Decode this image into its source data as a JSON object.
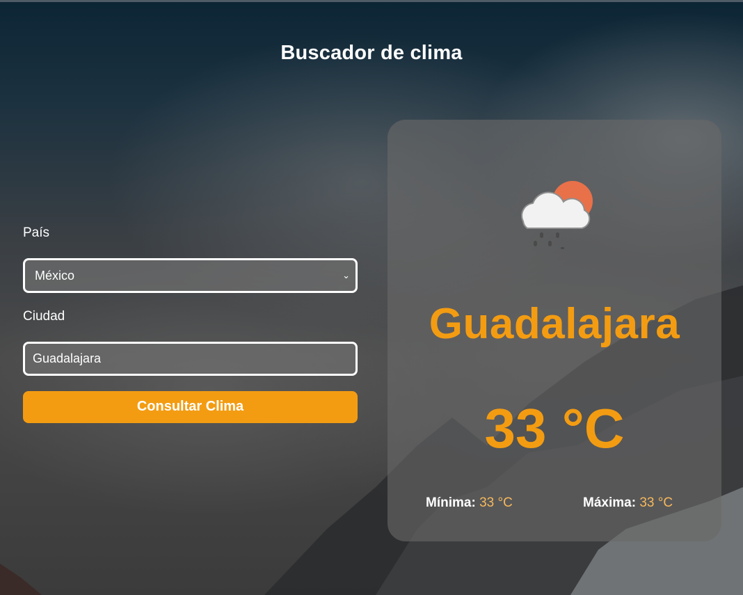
{
  "app": {
    "title": "Buscador de clima"
  },
  "form": {
    "country_label": "País",
    "country_value": "México",
    "city_label": "Ciudad",
    "city_value": "Guadalajara",
    "submit_label": "Consultar Clima"
  },
  "result": {
    "icon": "rain-cloud-sun-icon",
    "city": "Guadalajara",
    "temperature": "33 °C",
    "min_label": "Mínima:",
    "min_value": "33 °C",
    "max_label": "Máxima:",
    "max_value": "33 °C"
  },
  "colors": {
    "accent": "#f39c12",
    "text": "#ffffff"
  }
}
